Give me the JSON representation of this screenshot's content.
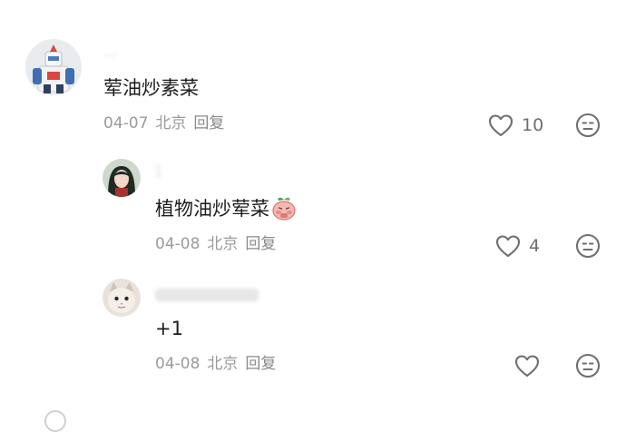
{
  "comments": [
    {
      "username": "…",
      "content": "荤油炒素菜",
      "date": "04-07",
      "location": "北京",
      "reply_label": "回复",
      "like_count": "10",
      "avatar_icon": "robot-figure-avatar"
    },
    {
      "username": "氵",
      "content": "植物油炒荤菜",
      "emoji_icon": "blushing-peach-emoji",
      "date": "04-08",
      "location": "北京",
      "reply_label": "回复",
      "like_count": "4",
      "avatar_icon": "dark-hair-portrait-avatar"
    },
    {
      "username": "",
      "content": "+1",
      "date": "04-08",
      "location": "北京",
      "reply_label": "回复",
      "like_count": "",
      "avatar_icon": "cat-avatar"
    }
  ],
  "colors": {
    "meta_text": "#9b9b9b",
    "icon_stroke": "#6f6f6f",
    "content_text": "#1c1c1c"
  }
}
